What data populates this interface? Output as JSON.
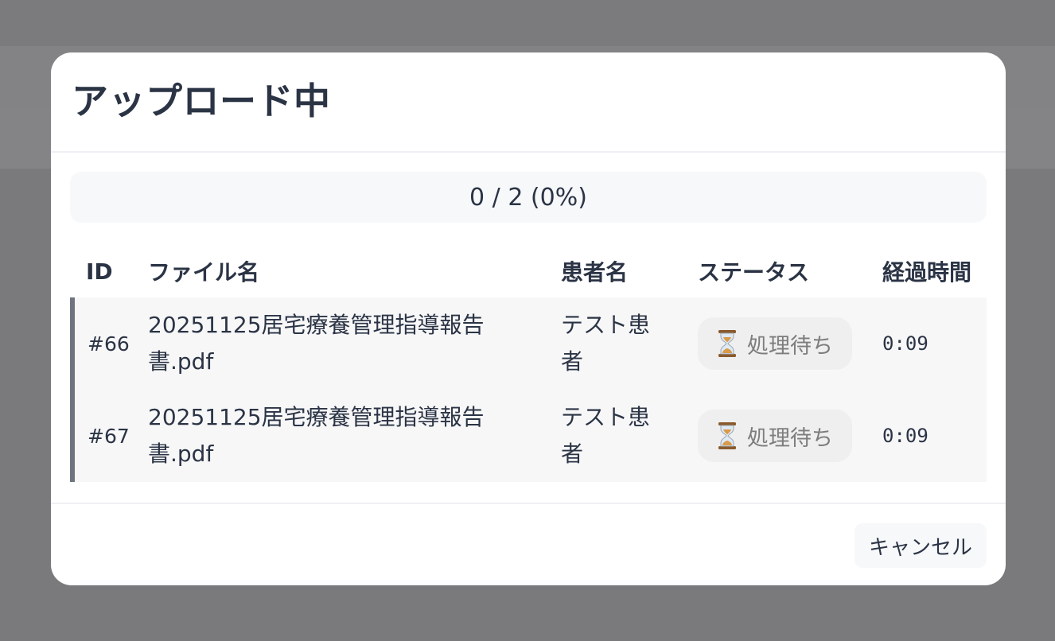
{
  "modal": {
    "title": "アップロード中",
    "progress_text": "0 / 2 (0%)",
    "progress_fraction": 0
  },
  "table": {
    "headers": [
      "ID",
      "ファイル名",
      "患者名",
      "ステータス",
      "経過時間"
    ],
    "rows": [
      {
        "id": "#66",
        "file_name": "20251125居宅療養管理指導報告書.pdf",
        "patient": "テスト患者",
        "status": "処理待ち",
        "status_icon": "hourglass-icon",
        "elapsed": "0:09"
      },
      {
        "id": "#67",
        "file_name": "20251125居宅療養管理指導報告書.pdf",
        "patient": "テスト患者",
        "status": "処理待ち",
        "status_icon": "hourglass-icon",
        "elapsed": "0:09"
      }
    ]
  },
  "footer": {
    "cancel_label": "キャンセル"
  },
  "colors": {
    "overlay": "#7a7a7c",
    "row_accent": "#6f7480",
    "badge_bg": "#efefef",
    "text": "#2b3445"
  }
}
